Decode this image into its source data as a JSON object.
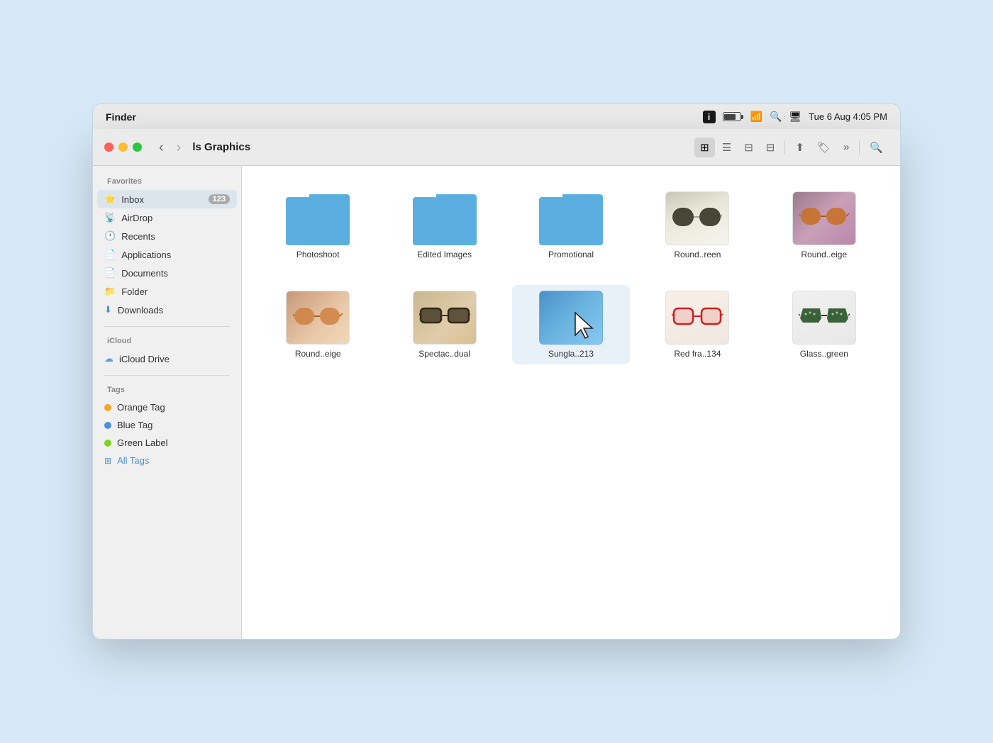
{
  "menubar": {
    "app_name": "Finder",
    "datetime": "Tue 6 Aug 4:05 PM"
  },
  "toolbar": {
    "path": "ls Graphics",
    "view_icons_label": "⊞",
    "view_list_label": "☰",
    "view_columns_label": "⊟",
    "view_gallery_label": "▭",
    "share_label": "⬆",
    "tags_label": "🏷",
    "more_label": "»",
    "search_label": "🔍"
  },
  "sidebar": {
    "favorites_title": "Favorites",
    "items": [
      {
        "id": "inbox",
        "label": "Inbox",
        "badge": "123",
        "icon": "⭐",
        "active": true
      },
      {
        "id": "airdrop",
        "label": "AirDrop",
        "icon": "📡"
      },
      {
        "id": "recents",
        "label": "Recents",
        "icon": "🕐"
      },
      {
        "id": "applications",
        "label": "Applications",
        "icon": "📄"
      },
      {
        "id": "documents",
        "label": "Documents",
        "icon": "📄"
      },
      {
        "id": "folder",
        "label": "Folder",
        "icon": "📁"
      },
      {
        "id": "downloads",
        "label": "Downloads",
        "icon": "⬇"
      }
    ],
    "icloud_title": "iCloud",
    "icloud_items": [
      {
        "id": "icloud-drive",
        "label": "iCloud Drive",
        "icon": "☁"
      }
    ],
    "tags_title": "Tags",
    "tag_items": [
      {
        "id": "orange-tag",
        "label": "Orange Tag",
        "color": "#f5a623"
      },
      {
        "id": "blue-tag",
        "label": "Blue Tag",
        "color": "#4a90d9"
      },
      {
        "id": "green-label",
        "label": "Green Label",
        "color": "#7ed321"
      },
      {
        "id": "all-tags",
        "label": "All Tags",
        "icon": "⊞"
      }
    ]
  },
  "files": [
    {
      "id": "photoshoot",
      "type": "folder",
      "label": "Photoshoot"
    },
    {
      "id": "edited-images",
      "type": "folder",
      "label": "Edited Images"
    },
    {
      "id": "promotional",
      "type": "folder",
      "label": "Promotional"
    },
    {
      "id": "round-green",
      "type": "image",
      "label": "Round..reen",
      "thumb": "dark-glasses-white"
    },
    {
      "id": "round-beige",
      "type": "image",
      "label": "Round..eige",
      "thumb": "brown-glasses-purple"
    },
    {
      "id": "round-beige2",
      "type": "image",
      "label": "Round..eige",
      "thumb": "brown-glasses-pink"
    },
    {
      "id": "spectac-dual",
      "type": "image",
      "label": "Spectac..dual",
      "thumb": "dark-glasses-beige"
    },
    {
      "id": "sungla-213",
      "type": "image",
      "label": "Sungla..213",
      "thumb": "blue-cursor",
      "has_cursor": true
    },
    {
      "id": "red-fra-134",
      "type": "image",
      "label": "Red fra..134",
      "thumb": "red-glasses-white"
    },
    {
      "id": "glass-green",
      "type": "image",
      "label": "Glass..green",
      "thumb": "green-glasses-white"
    }
  ],
  "colors": {
    "folder_blue": "#5aafe0",
    "sidebar_active_bg": "#dce4ec",
    "accent_blue": "#4a90d9"
  }
}
